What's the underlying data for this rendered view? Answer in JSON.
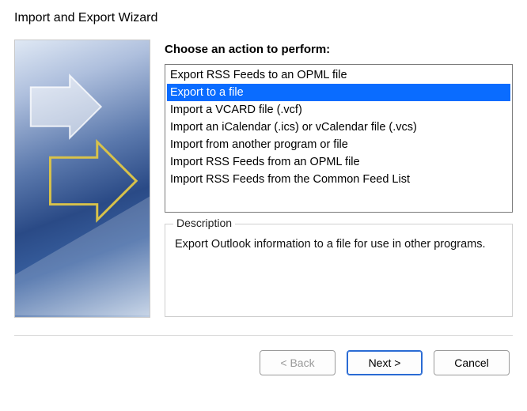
{
  "window": {
    "title": "Import and Export Wizard"
  },
  "prompt": "Choose an action to perform:",
  "actions": [
    {
      "label": "Export RSS Feeds to an OPML file",
      "selected": false
    },
    {
      "label": "Export to a file",
      "selected": true
    },
    {
      "label": "Import a VCARD file (.vcf)",
      "selected": false
    },
    {
      "label": "Import an iCalendar (.ics) or vCalendar file (.vcs)",
      "selected": false
    },
    {
      "label": "Import from another program or file",
      "selected": false
    },
    {
      "label": "Import RSS Feeds from an OPML file",
      "selected": false
    },
    {
      "label": "Import RSS Feeds from the Common Feed List",
      "selected": false
    }
  ],
  "description": {
    "legend": "Description",
    "text": "Export Outlook information to a file for use in other programs."
  },
  "buttons": {
    "back": "< Back",
    "next": "Next >",
    "cancel": "Cancel"
  }
}
